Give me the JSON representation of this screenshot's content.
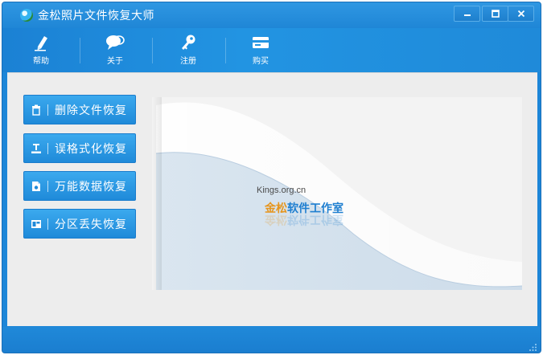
{
  "window": {
    "title": "金松照片文件恢复大师",
    "controls": {
      "minimize": "–",
      "maximize": "□",
      "close": "×"
    }
  },
  "toolbar": {
    "items": [
      {
        "label": "帮助",
        "icon": "pencil-icon"
      },
      {
        "label": "关于",
        "icon": "chat-bubble-icon"
      },
      {
        "label": "注册",
        "icon": "key-icon"
      },
      {
        "label": "购买",
        "icon": "card-icon"
      }
    ]
  },
  "sidebar": {
    "buttons": [
      {
        "label": "删除文件恢复",
        "icon": "trash-icon"
      },
      {
        "label": "误格式化恢复",
        "icon": "format-icon"
      },
      {
        "label": "万能数据恢复",
        "icon": "document-icon"
      },
      {
        "label": "分区丢失恢复",
        "icon": "partition-icon"
      }
    ]
  },
  "brand": {
    "url": "Kings.org.cn",
    "name_part1": "金松",
    "name_part2": "软件工作室"
  },
  "colors": {
    "accent": "#1f8ad9",
    "content_bg": "#ededed",
    "brand_orange": "#e6951d"
  }
}
